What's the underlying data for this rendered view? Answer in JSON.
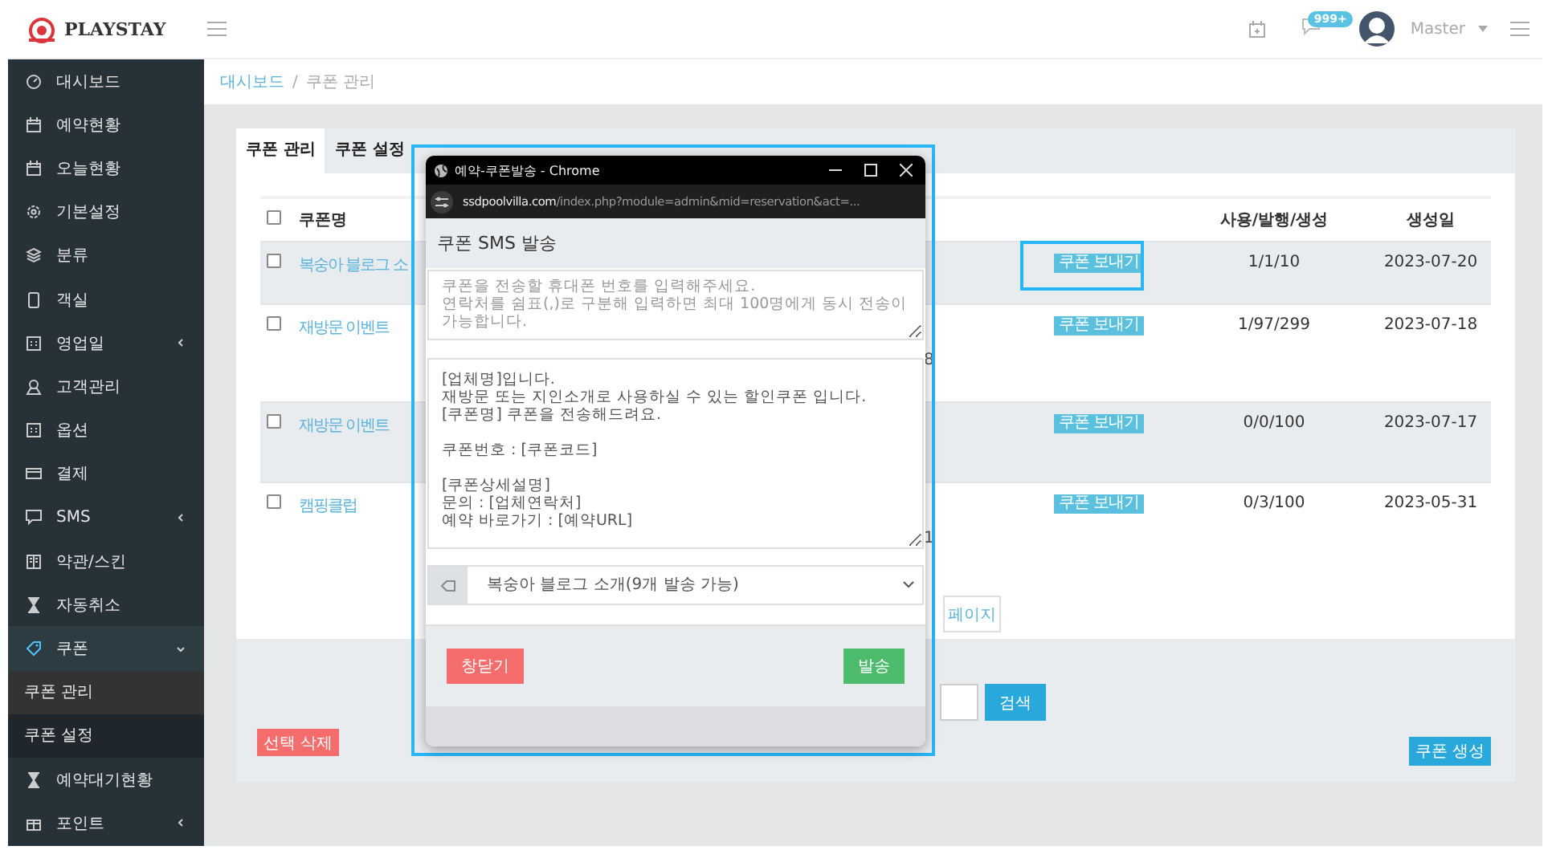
{
  "header": {
    "logo": "PLAYSTAY",
    "notification_badge": "999+",
    "user": "Master"
  },
  "sidebar": {
    "items": [
      {
        "label": "대시보드",
        "submenu": false,
        "expanded": false
      },
      {
        "label": "예약현황",
        "submenu": false,
        "expanded": false
      },
      {
        "label": "오늘현황",
        "submenu": false,
        "expanded": false
      },
      {
        "label": "기본설정",
        "submenu": false,
        "expanded": false
      },
      {
        "label": "분류",
        "submenu": false,
        "expanded": false
      },
      {
        "label": "객실",
        "submenu": false,
        "expanded": false
      },
      {
        "label": "영업일",
        "submenu": true,
        "expanded": false
      },
      {
        "label": "고객관리",
        "submenu": false,
        "expanded": false
      },
      {
        "label": "옵션",
        "submenu": false,
        "expanded": false
      },
      {
        "label": "결제",
        "submenu": false,
        "expanded": false
      },
      {
        "label": "SMS",
        "submenu": true,
        "expanded": false
      },
      {
        "label": "약관/스킨",
        "submenu": false,
        "expanded": false
      },
      {
        "label": "자동취소",
        "submenu": false,
        "expanded": false
      },
      {
        "label": "쿠폰",
        "submenu": true,
        "expanded": true,
        "children": [
          {
            "label": "쿠폰 관리",
            "selected": true
          },
          {
            "label": "쿠폰 설정",
            "selected": false
          }
        ]
      },
      {
        "label": "예약대기현황",
        "submenu": false,
        "expanded": false
      },
      {
        "label": "포인트",
        "submenu": true,
        "expanded": false
      }
    ]
  },
  "breadcrumb": {
    "items": [
      "대시보드",
      "쿠폰 관리"
    ],
    "separator": "/"
  },
  "tabs": [
    {
      "label": "쿠폰 관리",
      "selected": true
    },
    {
      "label": "쿠폰 설정",
      "selected": false
    }
  ],
  "table": {
    "select_all": {
      "checked": false
    },
    "columns": {
      "name": "쿠폰명",
      "count": "사용/발행/생성",
      "date": "생성일"
    },
    "rows": [
      {
        "checked": false,
        "name": "복숭아 블로그 소",
        "action": "쿠폰 보내기",
        "highlighted": true,
        "count": "1/1/10",
        "date": "2023-07-20"
      },
      {
        "checked": false,
        "name": "재방문 이벤트",
        "column_3": "8",
        "action": "쿠폰 보내기",
        "highlighted": false,
        "count": "1/97/299",
        "date": "2023-07-18"
      },
      {
        "checked": false,
        "name": "재방문 이벤트",
        "action": "쿠폰 보내기",
        "highlighted": false,
        "count": "0/0/100",
        "date": "2023-07-17"
      },
      {
        "checked": false,
        "name": "캠핑클럽",
        "column_3": "1",
        "action": "쿠폰 보내기",
        "highlighted": false,
        "count": "0/3/100",
        "date": "2023-05-31"
      }
    ]
  },
  "pagination": [
    "페이지"
  ],
  "search_button": "검색",
  "delete_button": "선택 삭제",
  "create_button": "쿠폰 생성",
  "popup": {
    "title": "예약-쿠폰발송 - Chrome",
    "url_domain": "ssdpoolvilla.com",
    "url_path": "/index.php?module=admin&mid=reservation&act=...",
    "heading": "쿠폰 SMS 발송",
    "phone_placeholder": "쿠폰을 전송할 휴대폰 번호를 입력해주세요.\n연락처를 쉼표(,)로 구분해 입력하면 최대 100명에게 동시 전송이 가능합니다.",
    "message": "[업체명]입니다.\n재방문 또는 지인소개로 사용하실 수 있는 할인쿠폰 입니다.\n[쿠폰명] 쿠폰을 전송해드려요.\n\n쿠폰번호 : [쿠폰코드]\n\n[쿠폰상세설명]\n문의 : [업체연락처]\n예약 바로가기 : [예약URL]",
    "coupon_select": "복숭아 블로그 소개(9개 발송 가능)",
    "close_button": "창닫기",
    "send_button": "발송"
  }
}
